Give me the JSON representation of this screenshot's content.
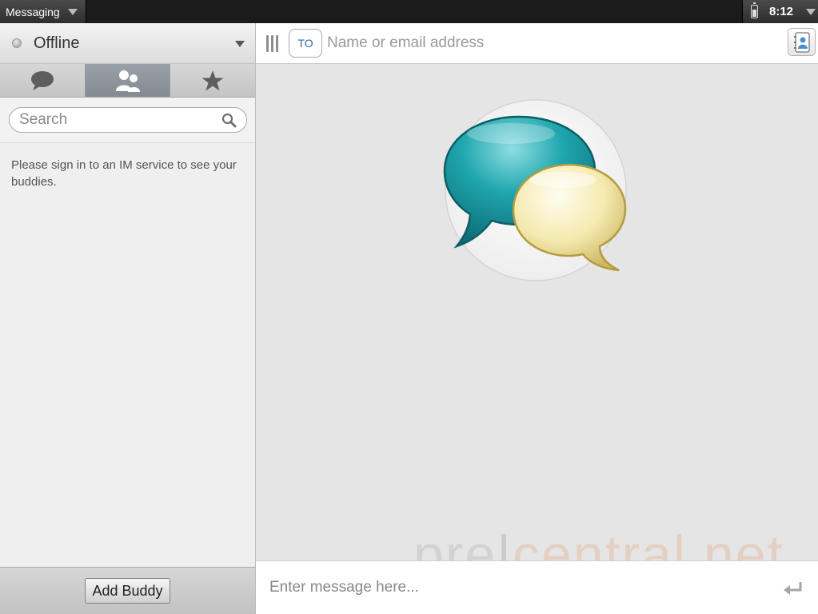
{
  "statusbar": {
    "app_name": "Messaging",
    "time": "8:12",
    "icons": [
      "chevron-down-icon",
      "battery-icon",
      "chevron-down-icon"
    ]
  },
  "sidebar": {
    "presence": {
      "status": "Offline"
    },
    "tabs": [
      {
        "id": "conversations",
        "icon": "chat-bubble-icon",
        "active": false
      },
      {
        "id": "buddies",
        "icon": "buddies-icon",
        "active": true
      },
      {
        "id": "favorites",
        "icon": "star-icon",
        "active": false
      }
    ],
    "search": {
      "placeholder": "Search"
    },
    "empty_message": "Please sign in to an IM service to see your buddies.",
    "add_buddy_label": "Add Buddy"
  },
  "conversation": {
    "to_label": "TO",
    "recipient_placeholder": "Name or email address",
    "compose_placeholder": "Enter message here...",
    "watermark": {
      "part1": "pre",
      "separator": "|",
      "part2": "central.net"
    }
  },
  "colors": {
    "accent_teal": "#1a9ba3",
    "accent_cream": "#f1e6a6",
    "to_label": "#2b6aa8",
    "active_tab": "#8b929a"
  }
}
